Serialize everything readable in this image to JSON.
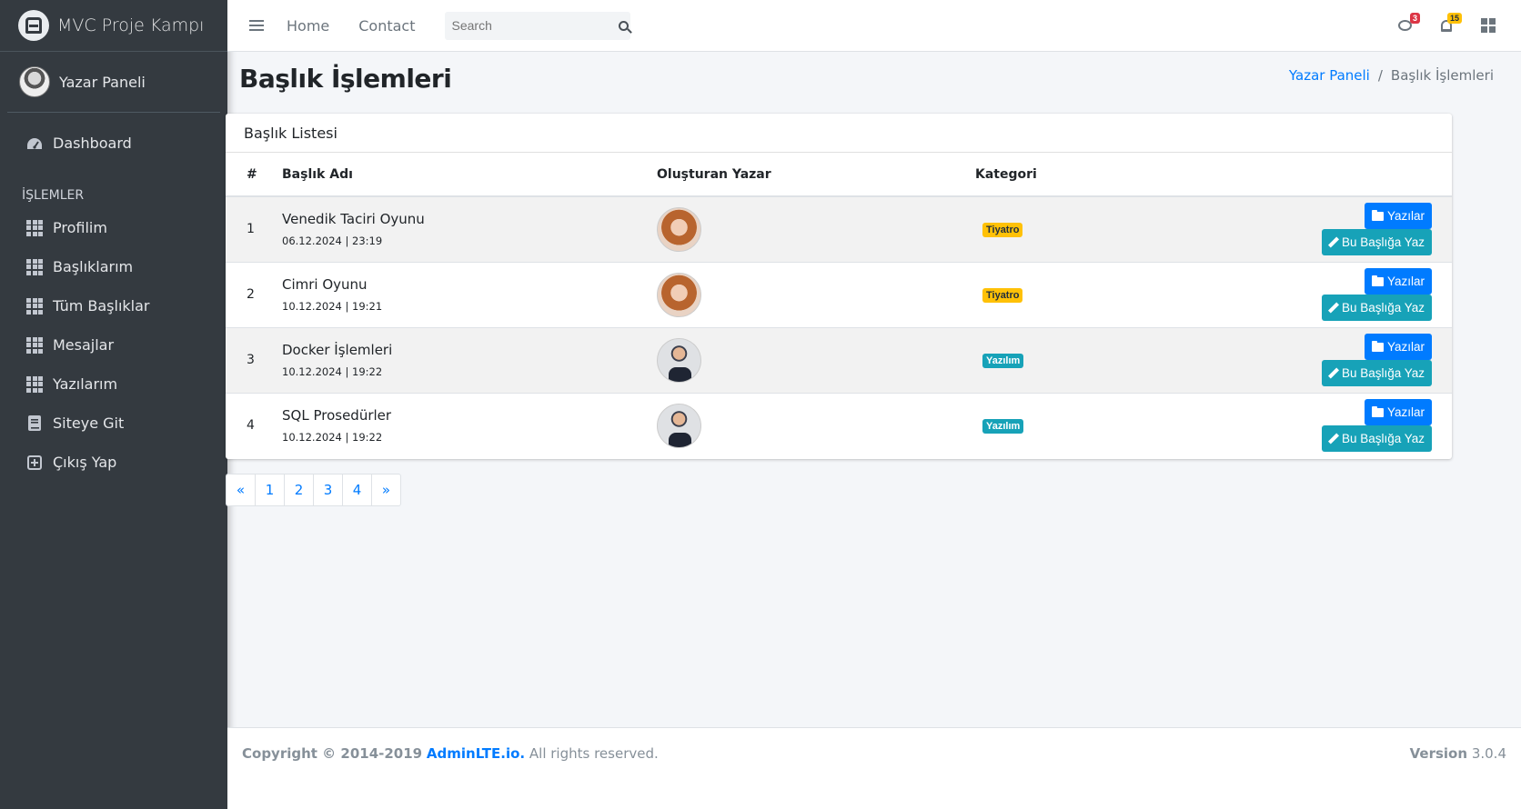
{
  "brand": {
    "name": "MVC Proje Kampı"
  },
  "user": {
    "name": "Yazar Paneli"
  },
  "sidebar": {
    "dashboard": "Dashboard",
    "section_header": "İŞLEMLER",
    "items": [
      {
        "label": "Profilim",
        "icon": "grid-icon"
      },
      {
        "label": "Başlıklarım",
        "icon": "grid-icon"
      },
      {
        "label": "Tüm Başlıklar",
        "icon": "grid-icon"
      },
      {
        "label": "Mesajlar",
        "icon": "grid-icon"
      },
      {
        "label": "Yazılarım",
        "icon": "grid-icon"
      },
      {
        "label": "Siteye Git",
        "icon": "book-icon"
      },
      {
        "label": "Çıkış Yap",
        "icon": "plus-square-icon"
      }
    ]
  },
  "navbar": {
    "home": "Home",
    "contact": "Contact",
    "search_placeholder": "Search",
    "messages_count": "3",
    "notifications_count": "15"
  },
  "header": {
    "title": "Başlık İşlemleri",
    "breadcrumb_parent": "Yazar Paneli",
    "breadcrumb_current": "Başlık İşlemleri"
  },
  "card": {
    "title": "Başlık Listesi",
    "columns": [
      "#",
      "Başlık Adı",
      "Oluşturan Yazar",
      "Kategori"
    ],
    "rows": [
      {
        "num": "1",
        "title": "Venedik Taciri Oyunu",
        "date": "06.12.2024 | 23:19",
        "category": "Tiyatro",
        "category_color": "#ffc107",
        "avatar": "female"
      },
      {
        "num": "2",
        "title": "Cimri Oyunu",
        "date": "10.12.2024 | 19:21",
        "category": "Tiyatro",
        "category_color": "#ffc107",
        "avatar": "female"
      },
      {
        "num": "3",
        "title": "Docker İşlemleri",
        "date": "10.12.2024 | 19:22",
        "category": "Yazılım",
        "category_color": "#17a2b8",
        "avatar": "male"
      },
      {
        "num": "4",
        "title": "SQL Prosedürler",
        "date": "10.12.2024 | 19:22",
        "category": "Yazılım",
        "category_color": "#17a2b8",
        "avatar": "male"
      }
    ],
    "btn_posts": "Yazılar",
    "btn_write": "Bu Başlığa Yaz"
  },
  "pagination": [
    "«",
    "1",
    "2",
    "3",
    "4",
    "»"
  ],
  "footer": {
    "copyright_prefix": "Copyright © 2014-2019",
    "brand_link": "AdminLTE.io.",
    "rights": "All rights reserved.",
    "version_label": "Version",
    "version_value": "3.0.4"
  }
}
